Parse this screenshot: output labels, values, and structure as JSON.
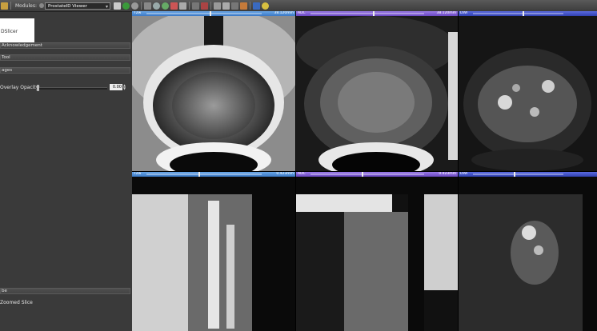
{
  "toolbar": {
    "modules_label": "Modules:",
    "module_selected": "ProstateID Viewer"
  },
  "left_panel": {
    "logo_text": "DSlicer",
    "sections": [
      {
        "label": "Acknowledgement"
      },
      {
        "label": "Tool"
      },
      {
        "label": "ages"
      }
    ],
    "overlay_opacity_label": "Overlay Opacity:",
    "overlay_opacity_value": "0.00",
    "bottom_section": {
      "label": "be"
    },
    "zoomed_slice_label": "Zoomed Slice"
  },
  "views": [
    {
      "label": "T2w",
      "value": "38.120mm",
      "color": "blue"
    },
    {
      "label": "ADC",
      "value": "38.120mm",
      "color": "purple"
    },
    {
      "label": "DWI",
      "value": "",
      "color": "indigo"
    },
    {
      "label": "T2w",
      "value": "0.423mm",
      "color": "blue"
    },
    {
      "label": "ADC",
      "value": "0.423mm",
      "color": "purple"
    },
    {
      "label": "DWI",
      "value": "",
      "color": "indigo"
    }
  ]
}
